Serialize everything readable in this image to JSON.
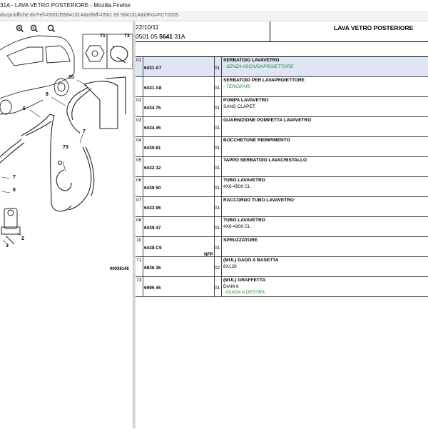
{
  "window": {
    "title": "31A - LAVA VETRO POSTERIORE - Mozilla Firefox",
    "url": "docpr/affiche.do?ref=050105564131A&refaff=0501 05 564131A&idFct=FCT0205"
  },
  "header": {
    "date": "22/10/11",
    "code_prefix": "0501 05 ",
    "code_bold": "5641",
    "code_suffix": " 31A",
    "title": "LAVA VETRO POSTERIORE"
  },
  "diagram": {
    "callouts": [
      "71",
      "73",
      "10",
      "8",
      "6",
      "7",
      "73",
      "7",
      "8",
      "2",
      "3"
    ],
    "code": "00038146"
  },
  "parts": [
    {
      "pos": "01",
      "ref": "6431 A7",
      "nfp": "",
      "qty": "01",
      "desc": "SERBATOIO LAVAVETRO",
      "sub": "- SENZA ASCIUGAPROIETTORE",
      "green": true,
      "selected": true
    },
    {
      "pos": "",
      "ref": "6431 A8",
      "nfp": "",
      "qty": "01",
      "desc": "SERBATOIO PER LAVAPROIETTORE",
      "sub": "- TERGIFARI",
      "green": true,
      "selected": false
    },
    {
      "pos": "02",
      "ref": "6434 75",
      "nfp": "",
      "qty": "01",
      "desc": "POMPA LAVAVETRO",
      "sub": "SANS CLAPET",
      "green": false,
      "selected": false
    },
    {
      "pos": "03",
      "ref": "6434 45",
      "nfp": "",
      "qty": "01",
      "desc": "GUARNIZIONE POMPETTA LAVAVETRO",
      "sub": "",
      "green": false,
      "selected": false
    },
    {
      "pos": "04",
      "ref": "6439 81",
      "nfp": "",
      "qty": "01",
      "desc": "BOCCHETONE RIEMPIMENTO",
      "sub": "",
      "green": false,
      "selected": false
    },
    {
      "pos": "05",
      "ref": "6432 32",
      "nfp": "",
      "qty": "01",
      "desc": "TAPPO SERBATOIO LAVACRISTALLO",
      "sub": "",
      "green": false,
      "selected": false
    },
    {
      "pos": "06",
      "ref": "6439 50",
      "nfp": "",
      "qty": "01",
      "desc": "TUBO LAVAVETRO",
      "sub": "4X6-4500 CL",
      "green": false,
      "selected": false
    },
    {
      "pos": "07",
      "ref": "6433 96",
      "nfp": "",
      "qty": "01",
      "desc": "RACCORDO TUBO LAVAVETRO",
      "sub": "",
      "green": false,
      "selected": false
    },
    {
      "pos": "08",
      "ref": "6439 47",
      "nfp": "",
      "qty": "01",
      "desc": "TUBO LAVAVETRO",
      "sub": "4X6-4300 CL",
      "green": false,
      "selected": false
    },
    {
      "pos": "10",
      "ref": "6438 C9",
      "nfp": "NFP",
      "qty": "01",
      "desc": "SPRUZZATORE",
      "sub": "",
      "green": false,
      "selected": false
    },
    {
      "pos": "71",
      "ref": "6836 36",
      "nfp": "",
      "qty": "02",
      "desc": "(MUL) DADO A BASETTA",
      "sub": "8X126",
      "green": false,
      "selected": false
    },
    {
      "pos": "73",
      "ref": "6995 45",
      "nfp": "",
      "qty": "01",
      "desc": "(MUL) GRAFFETTA",
      "sub": "DIAM 6",
      "sub2": "- GUIDA A DESTRA",
      "green": false,
      "selected": false
    }
  ]
}
